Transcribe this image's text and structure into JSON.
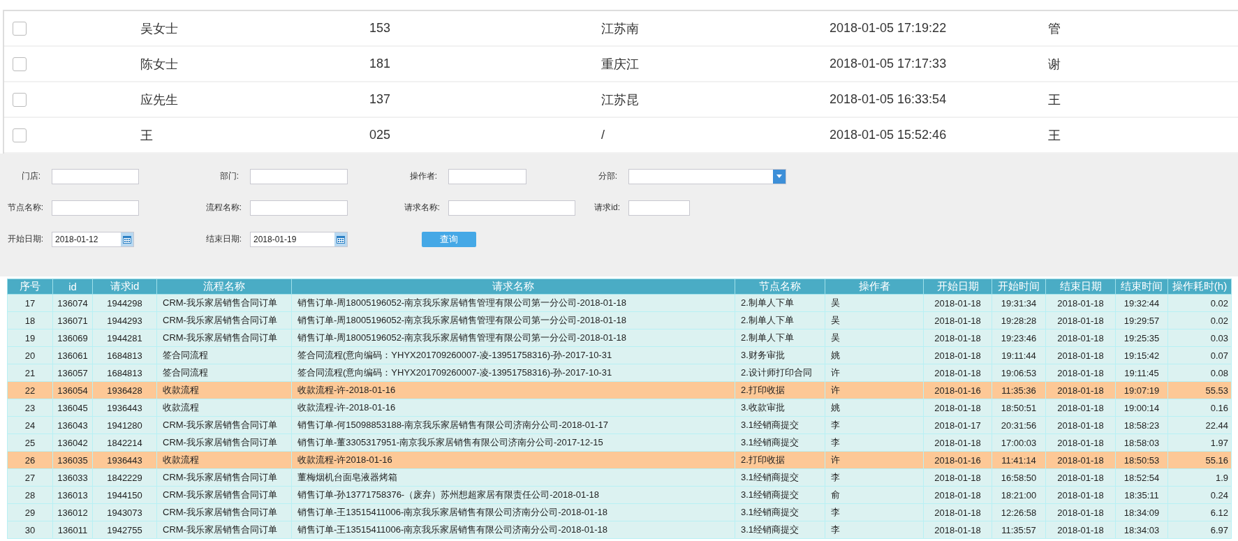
{
  "contacts": [
    {
      "checked": false,
      "name": "吴女士",
      "phone": "153",
      "address": "江苏南",
      "time": "2018-01-05 17:19:22",
      "staff": "管"
    },
    {
      "checked": false,
      "name": "陈女士",
      "phone": "181",
      "address": "重庆江",
      "time": "2018-01-05 17:17:33",
      "staff": "谢"
    },
    {
      "checked": false,
      "name": "应先生",
      "phone": "137",
      "address": "江苏昆",
      "time": "2018-01-05 16:33:54",
      "staff": "王"
    },
    {
      "checked": false,
      "name": "王",
      "phone": "025",
      "address": "/",
      "time": "2018-01-05 15:52:46",
      "staff": "王"
    }
  ],
  "filters": [
    [
      {
        "label": "门店:",
        "kind": "text"
      },
      {
        "label": "部门:",
        "kind": "text"
      },
      {
        "label": "操作者:",
        "kind": "text"
      },
      {
        "label": "分部:",
        "kind": "select"
      }
    ],
    [
      {
        "label": "节点名称:",
        "kind": "text"
      },
      {
        "label": "流程名称:",
        "kind": "text"
      },
      {
        "label": "请求名称:",
        "kind": "text"
      },
      {
        "label": "请求id:",
        "kind": "text"
      }
    ],
    [
      {
        "label": "开始日期:",
        "kind": "date",
        "value": "2018-01-12"
      },
      {
        "label": "结束日期:",
        "kind": "date",
        "value": "2018-01-19"
      },
      {
        "label": "查询",
        "kind": "button"
      }
    ]
  ],
  "table": {
    "columns": [
      "序号",
      "id",
      "请求id",
      "流程名称",
      "请求名称",
      "节点名称",
      "操作者",
      "开始日期",
      "开始时间",
      "结束日期",
      "结束时间",
      "操作耗时(h)"
    ],
    "rows": [
      {
        "highlighted": false,
        "cells": [
          "17",
          "136074",
          "1944298",
          "CRM-我乐家居销售合同订单",
          "销售订单-周18005196052-南京我乐家居销售管理有限公司第一分公司-2018-01-18",
          "2.制单人下单",
          "吴",
          "2018-01-18",
          "19:31:34",
          "2018-01-18",
          "19:32:44",
          "0.02"
        ]
      },
      {
        "highlighted": false,
        "cells": [
          "18",
          "136071",
          "1944293",
          "CRM-我乐家居销售合同订单",
          "销售订单-周18005196052-南京我乐家居销售管理有限公司第一分公司-2018-01-18",
          "2.制单人下单",
          "吴",
          "2018-01-18",
          "19:28:28",
          "2018-01-18",
          "19:29:57",
          "0.02"
        ]
      },
      {
        "highlighted": false,
        "cells": [
          "19",
          "136069",
          "1944281",
          "CRM-我乐家居销售合同订单",
          "销售订单-周18005196052-南京我乐家居销售管理有限公司第一分公司-2018-01-18",
          "2.制单人下单",
          "吴",
          "2018-01-18",
          "19:23:46",
          "2018-01-18",
          "19:25:35",
          "0.03"
        ]
      },
      {
        "highlighted": false,
        "cells": [
          "20",
          "136061",
          "1684813",
          "签合同流程",
          "签合同流程(意向编码：YHYX201709260007-凌-13951758316)-孙-2017-10-31",
          "3.财务审批",
          "姚",
          "2018-01-18",
          "19:11:44",
          "2018-01-18",
          "19:15:42",
          "0.07"
        ]
      },
      {
        "highlighted": false,
        "cells": [
          "21",
          "136057",
          "1684813",
          "签合同流程",
          "签合同流程(意向编码：YHYX201709260007-凌-13951758316)-孙-2017-10-31",
          "2.设计师打印合同",
          "许",
          "2018-01-18",
          "19:06:53",
          "2018-01-18",
          "19:11:45",
          "0.08"
        ]
      },
      {
        "highlighted": true,
        "cells": [
          "22",
          "136054",
          "1936428",
          "收款流程",
          "收款流程-许-2018-01-16",
          "2.打印收据",
          "许",
          "2018-01-16",
          "11:35:36",
          "2018-01-18",
          "19:07:19",
          "55.53"
        ]
      },
      {
        "highlighted": false,
        "cells": [
          "23",
          "136045",
          "1936443",
          "收款流程",
          "收款流程-许-2018-01-16",
          "3.收款审批",
          "姚",
          "2018-01-18",
          "18:50:51",
          "2018-01-18",
          "19:00:14",
          "0.16"
        ]
      },
      {
        "highlighted": false,
        "cells": [
          "24",
          "136043",
          "1941280",
          "CRM-我乐家居销售合同订单",
          "销售订单-何15098853188-南京我乐家居销售有限公司济南分公司-2018-01-17",
          "3.1经销商提交",
          "李",
          "2018-01-17",
          "20:31:56",
          "2018-01-18",
          "18:58:23",
          "22.44"
        ]
      },
      {
        "highlighted": false,
        "cells": [
          "25",
          "136042",
          "1842214",
          "CRM-我乐家居销售合同订单",
          "销售订单-董3305317951-南京我乐家居销售有限公司济南分公司-2017-12-15",
          "3.1经销商提交",
          "李",
          "2018-01-18",
          "17:00:03",
          "2018-01-18",
          "18:58:03",
          "1.97"
        ]
      },
      {
        "highlighted": true,
        "cells": [
          "26",
          "136035",
          "1936443",
          "收款流程",
          "收款流程-许2018-01-16",
          "2.打印收据",
          "许",
          "2018-01-16",
          "11:41:14",
          "2018-01-18",
          "18:50:53",
          "55.16"
        ]
      },
      {
        "highlighted": false,
        "cells": [
          "27",
          "136033",
          "1842229",
          "CRM-我乐家居销售合同订单",
          "董梅烟机台面皂液器烤箱",
          "3.1经销商提交",
          "李",
          "2018-01-18",
          "16:58:50",
          "2018-01-18",
          "18:52:54",
          "1.9"
        ]
      },
      {
        "highlighted": false,
        "cells": [
          "28",
          "136013",
          "1944150",
          "CRM-我乐家居销售合同订单",
          "销售订单-孙13771758376-（废弃）苏州想超家居有限责任公司-2018-01-18",
          "3.1经销商提交",
          "俞",
          "2018-01-18",
          "18:21:00",
          "2018-01-18",
          "18:35:11",
          "0.24"
        ]
      },
      {
        "highlighted": false,
        "cells": [
          "29",
          "136012",
          "1943073",
          "CRM-我乐家居销售合同订单",
          "销售订单-王13515411006-南京我乐家居销售有限公司济南分公司-2018-01-18",
          "3.1经销商提交",
          "李",
          "2018-01-18",
          "12:26:58",
          "2018-01-18",
          "18:34:09",
          "6.12"
        ]
      },
      {
        "highlighted": false,
        "cells": [
          "30",
          "136011",
          "1942755",
          "CRM-我乐家居销售合同订单",
          "销售订单-王13515411006-南京我乐家居销售有限公司济南分公司-2018-01-18",
          "3.1经销商提交",
          "李",
          "2018-01-18",
          "11:35:57",
          "2018-01-18",
          "18:34:03",
          "6.97"
        ]
      }
    ]
  }
}
